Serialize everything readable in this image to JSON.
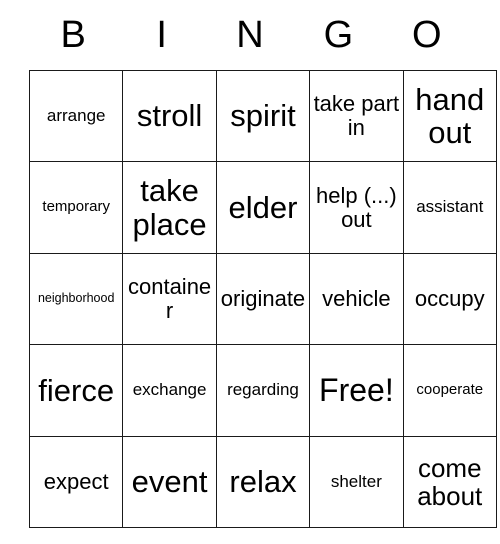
{
  "card": {
    "header": {
      "letters": [
        "B",
        "I",
        "N",
        "G",
        "O"
      ]
    },
    "free_space": {
      "row": 3,
      "col": 3
    },
    "rows": [
      [
        {
          "text": "arrange",
          "size": "fs-m"
        },
        {
          "text": "stroll",
          "size": "fs-xxl"
        },
        {
          "text": "spirit",
          "size": "fs-xxl"
        },
        {
          "text": "take part in",
          "size": "fs-l"
        },
        {
          "text": "hand out",
          "size": "fs-xxl"
        }
      ],
      [
        {
          "text": "temporary",
          "size": "fs-s"
        },
        {
          "text": "take place",
          "size": "fs-xxl"
        },
        {
          "text": "elder",
          "size": "fs-xxl"
        },
        {
          "text": "help (...) out",
          "size": "fs-l"
        },
        {
          "text": "assistant",
          "size": "fs-m"
        }
      ],
      [
        {
          "text": "neighborhood",
          "size": "fs-xs"
        },
        {
          "text": "container",
          "size": "fs-l"
        },
        {
          "text": "originate",
          "size": "fs-l"
        },
        {
          "text": "vehicle",
          "size": "fs-l"
        },
        {
          "text": "occupy",
          "size": "fs-l"
        }
      ],
      [
        {
          "text": "fierce",
          "size": "fs-xxl"
        },
        {
          "text": "exchange",
          "size": "fs-m"
        },
        {
          "text": "regarding",
          "size": "fs-m"
        },
        {
          "text": "Free!",
          "size": "fs-free"
        },
        {
          "text": "cooperate",
          "size": "fs-s"
        }
      ],
      [
        {
          "text": "expect",
          "size": "fs-l"
        },
        {
          "text": "event",
          "size": "fs-xxl"
        },
        {
          "text": "relax",
          "size": "fs-xxl"
        },
        {
          "text": "shelter",
          "size": "fs-m"
        },
        {
          "text": "come about",
          "size": "fs-xl"
        }
      ]
    ]
  },
  "colors": {
    "background": "#ffffff",
    "grid_line": "#1a1a1a",
    "text": "#000000"
  }
}
